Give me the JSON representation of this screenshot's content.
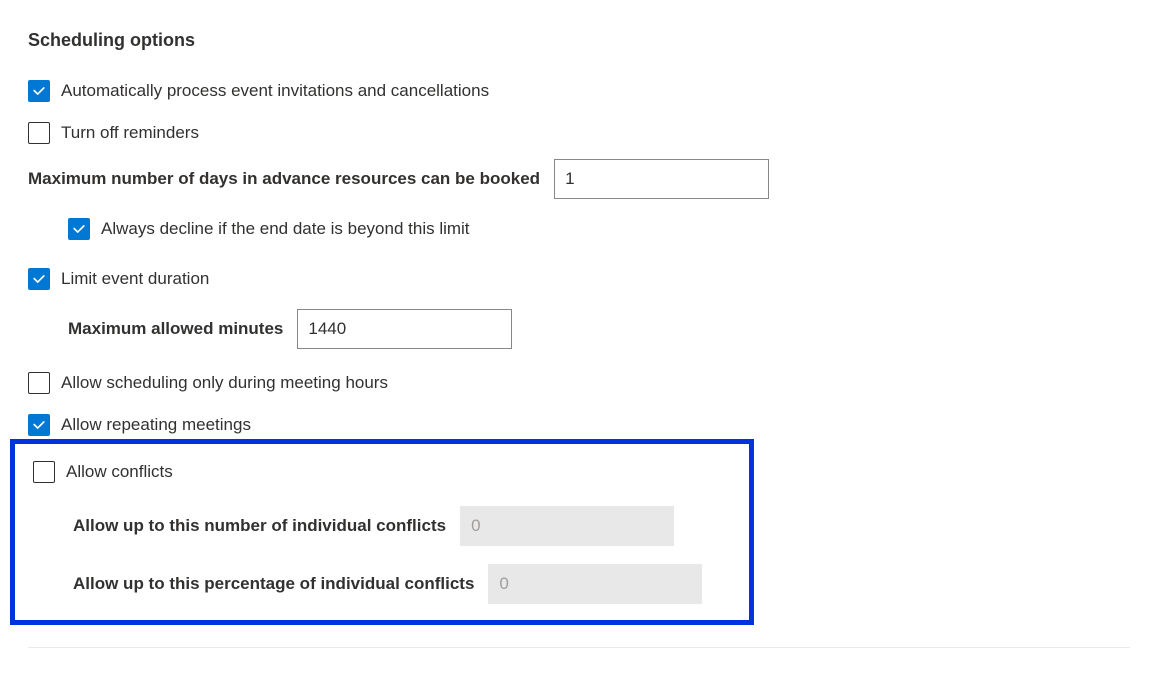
{
  "sectionTitle": "Scheduling options",
  "autoProcess": {
    "label": "Automatically process event invitations and cancellations",
    "checked": true
  },
  "turnOffReminders": {
    "label": "Turn off reminders",
    "checked": false
  },
  "maxDays": {
    "label": "Maximum number of days in advance resources can be booked",
    "value": "1"
  },
  "alwaysDecline": {
    "label": "Always decline if the end date is beyond this limit",
    "checked": true
  },
  "limitDuration": {
    "label": "Limit event duration",
    "checked": true
  },
  "maxMinutes": {
    "label": "Maximum allowed minutes",
    "value": "1440"
  },
  "scheduleOnlyHours": {
    "label": "Allow scheduling only during meeting hours",
    "checked": false
  },
  "allowRepeating": {
    "label": "Allow repeating meetings",
    "checked": true
  },
  "allowConflicts": {
    "label": "Allow conflicts",
    "checked": false
  },
  "numConflicts": {
    "label": "Allow up to this number of individual conflicts",
    "value": "0"
  },
  "pctConflicts": {
    "label": "Allow up to this percentage of individual conflicts",
    "value": "0"
  }
}
